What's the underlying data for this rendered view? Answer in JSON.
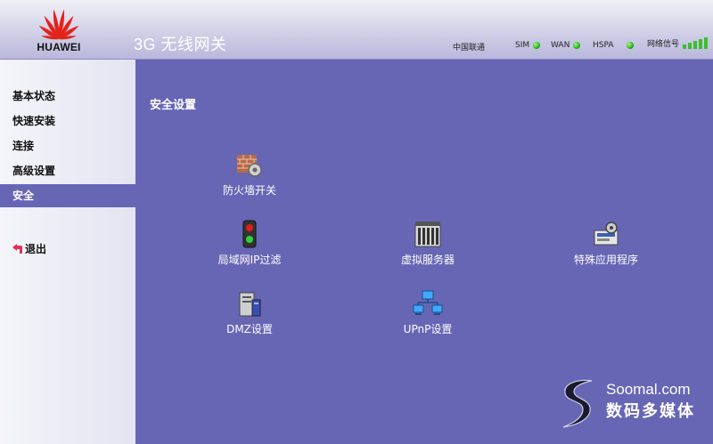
{
  "header": {
    "brand": "HUAWEI",
    "app_title": "3G 无线网关",
    "status": {
      "carrier": "中国联通",
      "sim_label": "SIM",
      "wan_label": "WAN",
      "hspa_label": "HSPA",
      "signal_label": "网络信号",
      "signal_level": 5,
      "signal_max": 5
    }
  },
  "sidebar": {
    "items": [
      {
        "label": "基本状态"
      },
      {
        "label": "快速安装"
      },
      {
        "label": "连接"
      },
      {
        "label": "高级设置"
      },
      {
        "label": "安全"
      }
    ],
    "active_index": 4,
    "logout": "退出"
  },
  "main": {
    "title": "安全设置",
    "tiles": [
      {
        "label": "防火墙开关",
        "icon": "firewall-icon"
      },
      {
        "label": "局域网IP过滤",
        "icon": "traffic-light-icon"
      },
      {
        "label": "虚拟服务器",
        "icon": "server-rack-icon"
      },
      {
        "label": "特殊应用程序",
        "icon": "special-app-icon"
      },
      {
        "label": "DMZ设置",
        "icon": "dmz-server-icon"
      },
      {
        "label": "UPnP设置",
        "icon": "network-computers-icon"
      }
    ]
  },
  "watermark": {
    "line1": "Soomal.com",
    "line2": "数码多媒体"
  },
  "colors": {
    "main_bg": "#6766b5",
    "active_nav": "#6766b5",
    "led": "#17a10f"
  }
}
